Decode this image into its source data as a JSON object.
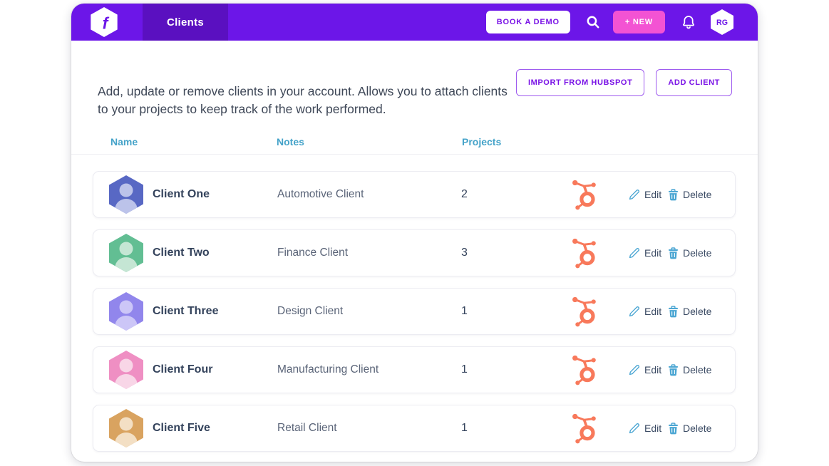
{
  "header": {
    "brand_glyph": "f",
    "active_tab": "Clients",
    "book_demo_label": "BOOK A DEMO",
    "new_button_label": "+ NEW",
    "avatar_initials": "RG"
  },
  "intro": {
    "description": "Add, update or remove clients in your account. Allows you to attach clients to your projects to keep track of the work performed.",
    "import_button_label": "IMPORT FROM HUBSPOT",
    "add_client_label": "ADD CLIENT"
  },
  "table": {
    "columns": [
      "Name",
      "Notes",
      "Projects"
    ],
    "edit_label": "Edit",
    "delete_label": "Delete",
    "rows": [
      {
        "name": "Client One",
        "notes": "Automotive Client",
        "projects": "2",
        "avatar_color": "#5868C4",
        "avatar_person_color": "#BCC3EA"
      },
      {
        "name": "Client Two",
        "notes": "Finance Client",
        "projects": "3",
        "avatar_color": "#62BE93",
        "avatar_person_color": "#C5E6D4"
      },
      {
        "name": "Client Three",
        "notes": "Design Client",
        "projects": "1",
        "avatar_color": "#9186EC",
        "avatar_person_color": "#CCC6F7"
      },
      {
        "name": "Client Four",
        "notes": "Manufacturing Client",
        "projects": "1",
        "avatar_color": "#EF8FC3",
        "avatar_person_color": "#F8D6E7"
      },
      {
        "name": "Client Five",
        "notes": "Retail Client",
        "projects": "1",
        "avatar_color": "#D9A360",
        "avatar_person_color": "#F3DFC4"
      }
    ]
  },
  "icons": {
    "brand": "hexagon-f-logo",
    "search": "magnifier",
    "notifications": "bell",
    "user": "hexagon-initials",
    "row_source": "hubspot-sprocket",
    "edit": "pencil",
    "delete": "trash"
  },
  "colors": {
    "header_purple": "#6C16E8",
    "tab_purple": "#5A10C0",
    "accent_pink": "#F353D3",
    "button_purple": "#7912E6",
    "button_border_purple": "#9E5BEF",
    "column_header_teal": "#45A3C9",
    "hubspot_orange": "#F8795B",
    "action_icon_blue": "#4BA6D3"
  }
}
